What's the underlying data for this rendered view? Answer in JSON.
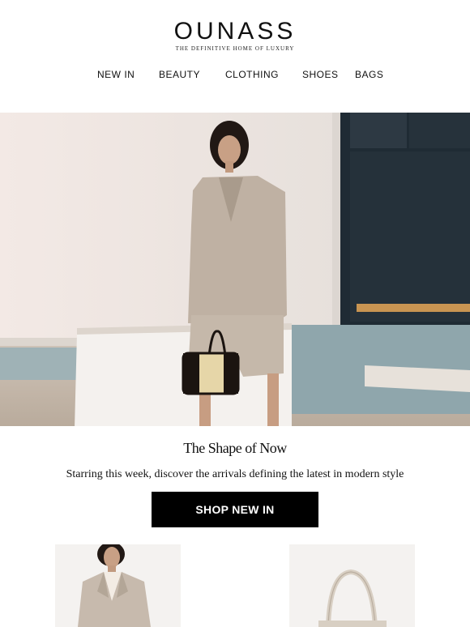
{
  "brand": {
    "logo": "OUNASS",
    "tagline": "THE DEFINITIVE HOME OF LUXURY"
  },
  "nav": {
    "items": [
      "NEW IN",
      "BEAUTY",
      "CLOTHING",
      "SHOES",
      "BAGS"
    ]
  },
  "campaign": {
    "headline": "The Shape of Now",
    "subtext": "Starring this week, discover the arrivals defining the latest in modern style",
    "cta_label": "SHOP NEW IN"
  },
  "colors": {
    "background": "#ffffff",
    "cta_background": "#000000",
    "cta_text": "#ffffff",
    "suit": "#bfb1a3",
    "wall": "#ece7e3",
    "pool": "#8fa6ac"
  }
}
